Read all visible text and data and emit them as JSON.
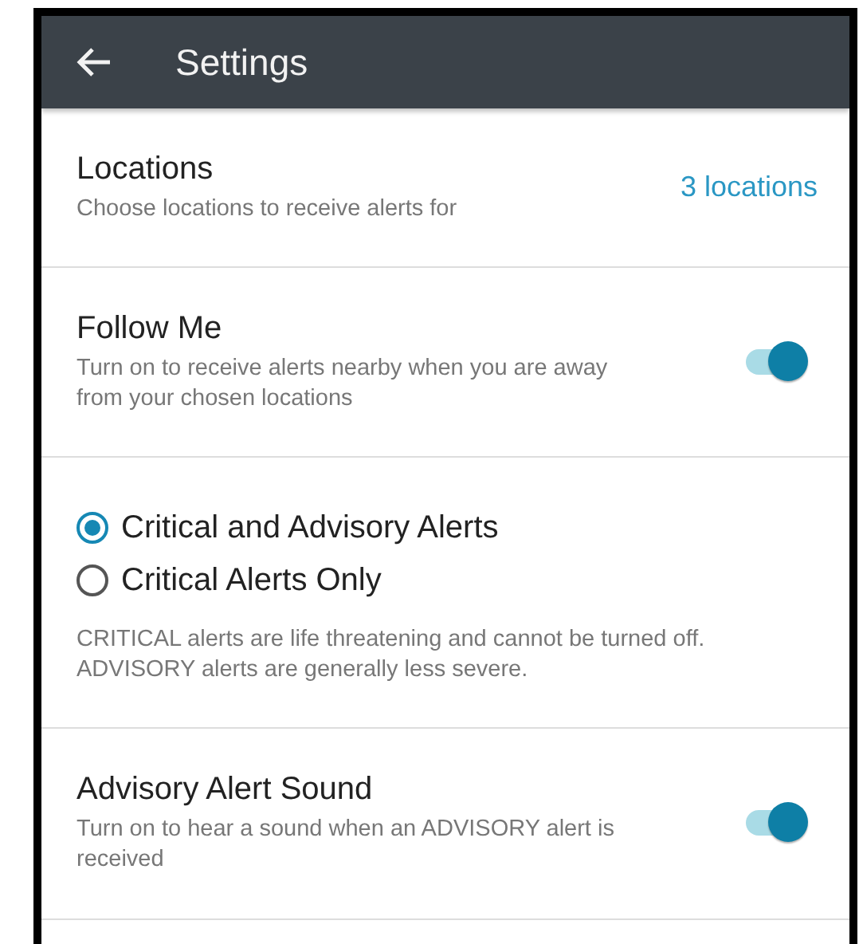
{
  "app_bar": {
    "title": "Settings"
  },
  "sections": [
    {
      "kind": "link",
      "title": "Locations",
      "description": "Choose locations to receive alerts for",
      "value": "3 locations"
    },
    {
      "kind": "toggle",
      "title": "Follow Me",
      "description": "Turn on to receive alerts nearby when you are away from your chosen locations",
      "on": true
    },
    {
      "kind": "radio",
      "options": [
        {
          "label": "Critical and Advisory Alerts",
          "selected": true
        },
        {
          "label": "Critical Alerts Only",
          "selected": false
        }
      ],
      "description": "CRITICAL alerts are life threatening and cannot be turned off. ADVISORY alerts are generally less severe."
    },
    {
      "kind": "toggle",
      "title": "Advisory Alert Sound",
      "description": "Turn on to hear a sound when an ADVISORY alert is received",
      "on": true
    }
  ]
}
